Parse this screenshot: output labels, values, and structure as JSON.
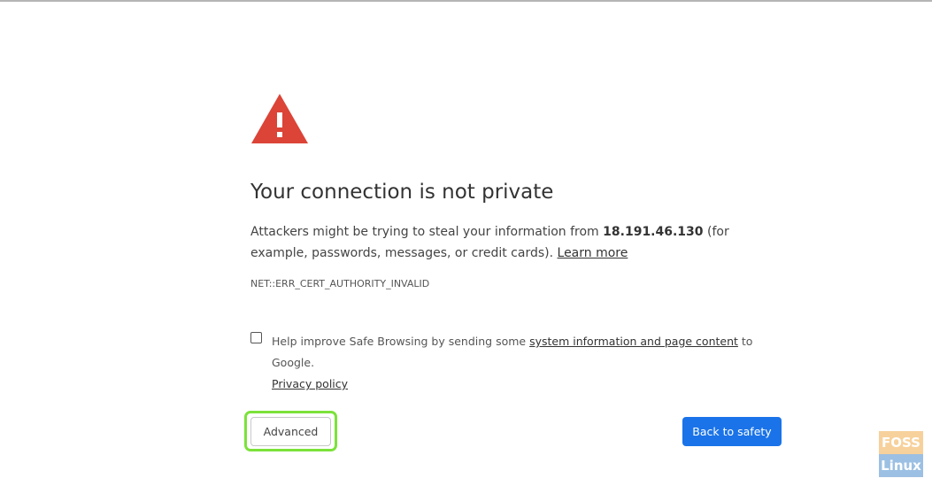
{
  "page": {
    "title": "Your connection is not private",
    "message": {
      "prefix": "Attackers might be trying to steal your information from ",
      "host": "18.191.46.130",
      "suffix": " (for example, passwords, messages, or credit cards). ",
      "learn_more": "Learn more"
    },
    "error_code": "NET::ERR_CERT_AUTHORITY_INVALID",
    "safe_browsing": {
      "checked": false,
      "prefix": "Help improve Safe Browsing by sending some ",
      "link": "system information and page content",
      "suffix": " to Google.",
      "privacy_link": "Privacy policy"
    },
    "buttons": {
      "advanced": "Advanced",
      "back_to_safety": "Back to safety"
    }
  },
  "icons": {
    "warning": "warning-triangle-icon"
  },
  "colors": {
    "warning_red": "#db4437",
    "primary_blue": "#1a73e8",
    "highlight_green": "#7ce23a"
  },
  "watermark": {
    "top": "FOSS",
    "bottom": "Linux"
  }
}
